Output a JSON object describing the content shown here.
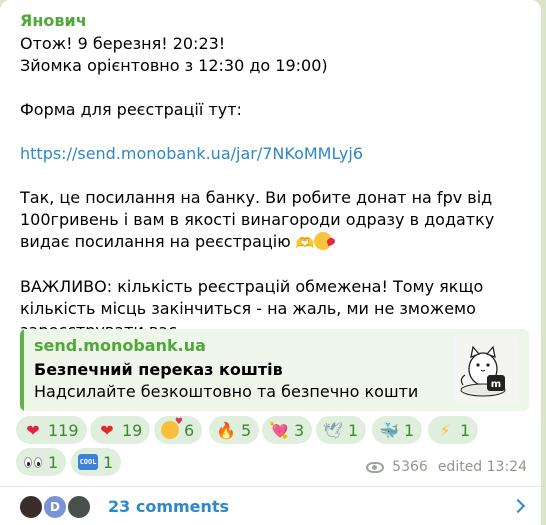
{
  "message": {
    "sender": "Янович",
    "lines_block1": "Отож! 9 березня! 20:23!\nЗйомка орієнтовно з 12:30 до 19:00)",
    "form_line": "Форма для реєстрації тут:",
    "link": "https://send.monobank.ua/jar/7NKoMMLyj6",
    "paragraph2": "Так, це посилання на банку. Ви робите донат на fpv від 100гривень і вам в якості винагороди одразу в додатку видає посилання на реєстрацію",
    "paragraph3": "ВАЖЛИВО: кількість реєстрацій обмежена! Тому якщо кількість місць закінчиться - на жаль, ми не зможемо зареєструвати вас.",
    "emojis_after_p2": [
      "heart-hands-icon",
      "kiss-face-icon"
    ]
  },
  "link_preview": {
    "site": "send.monobank.ua",
    "title": "Безпечний переказ коштів",
    "description": "Надсилайте безкоштовно та безпечно кошти",
    "thumbnail_icon": "monobank-cat-icon",
    "thumbnail_badge": "m"
  },
  "reactions": [
    {
      "icon": "red-heart-icon",
      "glyph": "❤",
      "count": "119"
    },
    {
      "icon": "heart-on-fire-icon",
      "glyph": "❤",
      "count": "19"
    },
    {
      "icon": "smiling-face-hearts-icon",
      "glyph": "",
      "count": "6"
    },
    {
      "icon": "fire-icon",
      "glyph": "🔥",
      "count": "5"
    },
    {
      "icon": "heart-arrow-icon",
      "glyph": "💘",
      "count": "3"
    },
    {
      "icon": "dove-icon",
      "glyph": "🕊",
      "count": "1"
    },
    {
      "icon": "whale-icon",
      "glyph": "🐳",
      "count": "1"
    },
    {
      "icon": "lightning-icon",
      "glyph": "⚡",
      "count": "1"
    },
    {
      "icon": "eyes-icon",
      "glyph": "",
      "count": "1"
    },
    {
      "icon": "cool-button-icon",
      "glyph": "COOL",
      "count": "1"
    }
  ],
  "meta": {
    "views": "5366",
    "edited": "edited 13:24"
  },
  "comments": {
    "label": "23 comments",
    "avatar_letter": "D"
  },
  "colors": {
    "sender": "#50a83a",
    "link": "#2e87c9",
    "reaction_bg": "#dfeedd",
    "preview_bg": "#eef6e9"
  }
}
